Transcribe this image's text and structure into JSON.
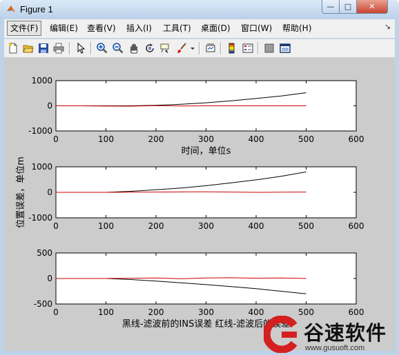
{
  "window": {
    "title": "Figure 1",
    "controls": {
      "minimize": "—",
      "maximize": "□",
      "close": "✕"
    }
  },
  "menu": {
    "items": [
      {
        "label": "文件(F)",
        "active": true
      },
      {
        "label": "编辑(E)"
      },
      {
        "label": "查看(V)"
      },
      {
        "label": "插入(I)"
      },
      {
        "label": "工具(T)"
      },
      {
        "label": "桌面(D)"
      },
      {
        "label": "窗口(W)"
      },
      {
        "label": "帮助(H)"
      }
    ],
    "dock_arrow": "↘"
  },
  "toolbar": {
    "icons": [
      "new-figure-icon",
      "open-file-icon",
      "save-icon",
      "print-icon",
      "pointer-icon",
      "zoom-in-icon",
      "zoom-out-icon",
      "pan-hand-icon",
      "rotate-3d-icon",
      "data-cursor-icon",
      "brush-icon",
      "brush-dropdown-icon",
      "link-plot-icon",
      "colorbar-icon",
      "legend-icon",
      "hide-plot-tools-icon",
      "show-plot-tools-icon"
    ]
  },
  "colors": {
    "series_black": "#000000",
    "series_red": "#cc0000",
    "figure_bg": "#cccccc"
  },
  "chart_data": [
    {
      "type": "line",
      "title": "",
      "xlabel": "时间，单位s",
      "ylabel": "",
      "xlim": [
        0,
        600
      ],
      "ylim": [
        -1000,
        1000
      ],
      "xticks": [
        "0",
        "100",
        "200",
        "300",
        "400",
        "500",
        "600"
      ],
      "yticks": [
        "-1000",
        "0",
        "1000"
      ],
      "series": [
        {
          "color": "#000000",
          "x": [
            0,
            50,
            100,
            150,
            200,
            250,
            300,
            350,
            400,
            450,
            500
          ],
          "y": [
            0,
            0,
            0,
            0,
            20,
            60,
            120,
            200,
            290,
            390,
            520
          ]
        },
        {
          "color": "#cc0000",
          "x": [
            0,
            50,
            100,
            150,
            200,
            250,
            300,
            350,
            400,
            450,
            500
          ],
          "y": [
            0,
            0,
            -10,
            -15,
            5,
            -5,
            0,
            0,
            0,
            0,
            0
          ]
        }
      ]
    },
    {
      "type": "line",
      "title": "",
      "xlabel": "",
      "ylabel": "位置误差，单位m",
      "xlim": [
        0,
        600
      ],
      "ylim": [
        -1000,
        1000
      ],
      "xticks": [
        "0",
        "100",
        "200",
        "300",
        "400",
        "500",
        "600"
      ],
      "yticks": [
        "-1000",
        "0",
        "1000"
      ],
      "series": [
        {
          "color": "#000000",
          "x": [
            0,
            50,
            100,
            150,
            200,
            250,
            300,
            350,
            400,
            450,
            500
          ],
          "y": [
            0,
            0,
            0,
            40,
            100,
            170,
            260,
            370,
            490,
            630,
            800
          ]
        },
        {
          "color": "#cc0000",
          "x": [
            0,
            50,
            100,
            150,
            200,
            250,
            300,
            350,
            400,
            450,
            500
          ],
          "y": [
            0,
            0,
            0,
            5,
            10,
            15,
            20,
            10,
            0,
            5,
            10
          ]
        }
      ]
    },
    {
      "type": "line",
      "title": "",
      "xlabel": "黑线-滤波前的INS误差   红线-滤波后的误差",
      "ylabel": "",
      "xlim": [
        0,
        600
      ],
      "ylim": [
        -500,
        500
      ],
      "xticks": [
        "0",
        "100",
        "200",
        "300",
        "400",
        "500",
        "600"
      ],
      "yticks": [
        "-500",
        "0",
        "500"
      ],
      "series": [
        {
          "color": "#000000",
          "x": [
            0,
            50,
            100,
            150,
            200,
            250,
            300,
            350,
            400,
            450,
            500
          ],
          "y": [
            0,
            0,
            0,
            -20,
            -50,
            -85,
            -120,
            -160,
            -200,
            -250,
            -300
          ]
        },
        {
          "color": "#cc0000",
          "x": [
            0,
            50,
            100,
            150,
            200,
            250,
            300,
            350,
            400,
            450,
            500
          ],
          "y": [
            0,
            0,
            0,
            5,
            10,
            -5,
            10,
            15,
            5,
            10,
            0
          ]
        }
      ]
    }
  ],
  "watermark": {
    "name": "谷速软件",
    "url": "www.gusuoft.com"
  }
}
